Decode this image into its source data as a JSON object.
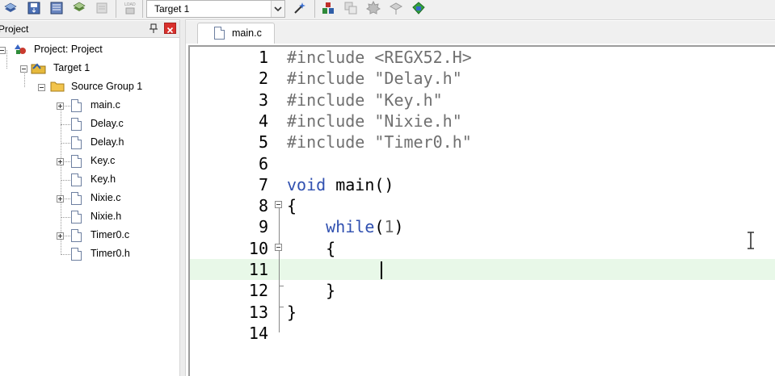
{
  "toolbar": {
    "target_selected": "Target 1",
    "icons": [
      "stack-icon",
      "save-icon",
      "batch-build-icon",
      "layers-icon",
      "disabled-tool-icon",
      "load-icon",
      "options-wand-icon",
      "manage-project-icon",
      "copy-icon",
      "gear-icon",
      "pack-installer-icon",
      "components-icon"
    ]
  },
  "project_pane": {
    "title": "Project",
    "tree": {
      "root": "Project: Project",
      "target": "Target 1",
      "group": "Source Group 1",
      "files": [
        "main.c",
        "Delay.c",
        "Delay.h",
        "Key.c",
        "Key.h",
        "Nixie.c",
        "Nixie.h",
        "Timer0.c",
        "Timer0.h"
      ]
    }
  },
  "editor": {
    "tab_label": "main.c",
    "current_line": 11,
    "colors": {
      "keyword": "#3050b0",
      "default": "#000000",
      "directive": "#707070",
      "current_line_bg": "#e8f8e8"
    },
    "lines": [
      {
        "n": "1",
        "text": "#include <REGX52.H>"
      },
      {
        "n": "2",
        "text": "#include \"Delay.h\""
      },
      {
        "n": "3",
        "text": "#include \"Key.h\""
      },
      {
        "n": "4",
        "text": "#include \"Nixie.h\""
      },
      {
        "n": "5",
        "text": "#include \"Timer0.h\""
      },
      {
        "n": "6",
        "text": ""
      },
      {
        "n": "7",
        "text": "void main()"
      },
      {
        "n": "8",
        "text": "{"
      },
      {
        "n": "9",
        "text": "    while(1)"
      },
      {
        "n": "10",
        "text": "    {"
      },
      {
        "n": "11",
        "text": ""
      },
      {
        "n": "12",
        "text": "    }"
      },
      {
        "n": "13",
        "text": "}"
      },
      {
        "n": "14",
        "text": ""
      }
    ]
  }
}
